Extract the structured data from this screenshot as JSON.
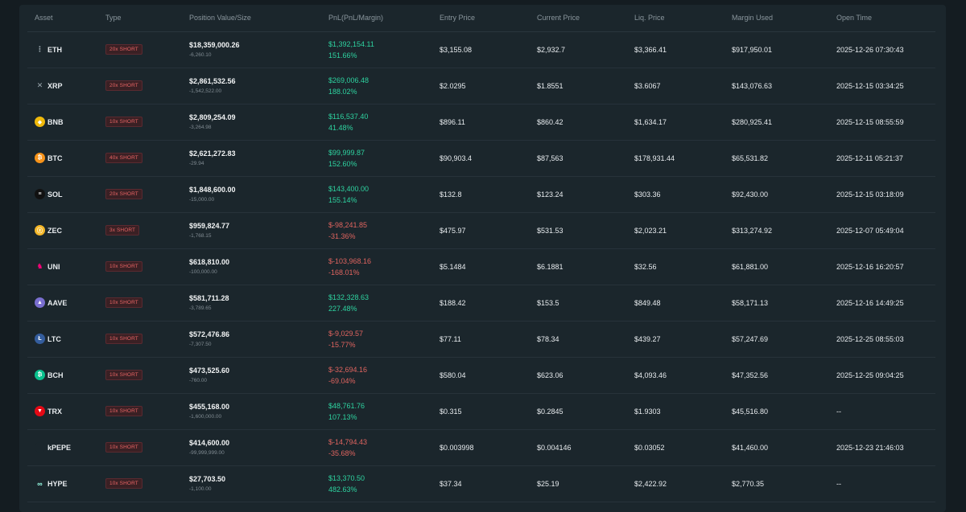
{
  "columns": [
    "Asset",
    "Type",
    "Position Value/Size",
    "PnL(PnL/Margin)",
    "Entry Price",
    "Current Price",
    "Liq. Price",
    "Margin Used",
    "Open Time"
  ],
  "colors": {
    "positive": "#2ed3a0",
    "negative": "#e0645f",
    "badge_text": "#e86464",
    "panel": "#1b262c",
    "background": "#141c21"
  },
  "rows": [
    {
      "asset": "ETH",
      "icon": "eth-icon",
      "icon_color": "#1b262c",
      "icon_glyph": "⋮",
      "type": "20x SHORT",
      "value": "$18,359,000.26",
      "size": "-6,260.10",
      "pnl": "$1,392,154.11",
      "pnl_pct": "151.66%",
      "pnl_sign": "pos",
      "entry": "$3,155.08",
      "current": "$2,932.7",
      "liq": "$3,366.41",
      "margin": "$917,950.01",
      "open_time": "2025-12-26 07:30:43"
    },
    {
      "asset": "XRP",
      "icon": "xrp-icon",
      "icon_color": "#1b262c",
      "icon_glyph": "✕",
      "type": "20x SHORT",
      "value": "$2,861,532.56",
      "size": "-1,542,522.00",
      "pnl": "$269,006.48",
      "pnl_pct": "188.02%",
      "pnl_sign": "pos",
      "entry": "$2.0295",
      "current": "$1.8551",
      "liq": "$3.6067",
      "margin": "$143,076.63",
      "open_time": "2025-12-15 03:34:25"
    },
    {
      "asset": "BNB",
      "icon": "bnb-icon",
      "icon_color": "#f0b90b",
      "icon_glyph": "◆",
      "type": "10x SHORT",
      "value": "$2,809,254.09",
      "size": "-3,264.98",
      "pnl": "$116,537.40",
      "pnl_pct": "41.48%",
      "pnl_sign": "pos",
      "entry": "$896.11",
      "current": "$860.42",
      "liq": "$1,634.17",
      "margin": "$280,925.41",
      "open_time": "2025-12-15 08:55:59"
    },
    {
      "asset": "BTC",
      "icon": "btc-icon",
      "icon_color": "#f7931a",
      "icon_glyph": "₿",
      "type": "40x SHORT",
      "value": "$2,621,272.83",
      "size": "-29.94",
      "pnl": "$99,999.87",
      "pnl_pct": "152.60%",
      "pnl_sign": "pos",
      "entry": "$90,903.4",
      "current": "$87,563",
      "liq": "$178,931.44",
      "margin": "$65,531.82",
      "open_time": "2025-12-11 05:21:37"
    },
    {
      "asset": "SOL",
      "icon": "sol-icon",
      "icon_color": "#111111",
      "icon_glyph": "≡",
      "type": "20x SHORT",
      "value": "$1,848,600.00",
      "size": "-15,000.00",
      "pnl": "$143,400.00",
      "pnl_pct": "155.14%",
      "pnl_sign": "pos",
      "entry": "$132.8",
      "current": "$123.24",
      "liq": "$303.36",
      "margin": "$92,430.00",
      "open_time": "2025-12-15 03:18:09"
    },
    {
      "asset": "ZEC",
      "icon": "zec-icon",
      "icon_color": "#f4b728",
      "icon_glyph": "ⓩ",
      "type": "3x SHORT",
      "value": "$959,824.77",
      "size": "-1,768.15",
      "pnl": "$-98,241.85",
      "pnl_pct": "-31.36%",
      "pnl_sign": "neg",
      "entry": "$475.97",
      "current": "$531.53",
      "liq": "$2,023.21",
      "margin": "$313,274.92",
      "open_time": "2025-12-07 05:49:04"
    },
    {
      "asset": "UNI",
      "icon": "uni-icon",
      "icon_color": "#1b262c",
      "icon_glyph": "♞",
      "type": "10x SHORT",
      "value": "$618,810.00",
      "size": "-100,000.00",
      "pnl": "$-103,968.16",
      "pnl_pct": "-168.01%",
      "pnl_sign": "neg",
      "entry": "$5.1484",
      "current": "$6.1881",
      "liq": "$32.56",
      "margin": "$61,881.00",
      "open_time": "2025-12-16 16:20:57"
    },
    {
      "asset": "AAVE",
      "icon": "aave-icon",
      "icon_color": "#7a6fd0",
      "icon_glyph": "▲",
      "type": "10x SHORT",
      "value": "$581,711.28",
      "size": "-3,789.65",
      "pnl": "$132,328.63",
      "pnl_pct": "227.48%",
      "pnl_sign": "pos",
      "entry": "$188.42",
      "current": "$153.5",
      "liq": "$849.48",
      "margin": "$58,171.13",
      "open_time": "2025-12-16 14:49:25"
    },
    {
      "asset": "LTC",
      "icon": "ltc-icon",
      "icon_color": "#345d9d",
      "icon_glyph": "Ł",
      "type": "10x SHORT",
      "value": "$572,476.86",
      "size": "-7,307.50",
      "pnl": "$-9,029.57",
      "pnl_pct": "-15.77%",
      "pnl_sign": "neg",
      "entry": "$77.11",
      "current": "$78.34",
      "liq": "$439.27",
      "margin": "$57,247.69",
      "open_time": "2025-12-25 08:55:03"
    },
    {
      "asset": "BCH",
      "icon": "bch-icon",
      "icon_color": "#0ac18e",
      "icon_glyph": "₿",
      "type": "10x SHORT",
      "value": "$473,525.60",
      "size": "-760.00",
      "pnl": "$-32,694.16",
      "pnl_pct": "-69.04%",
      "pnl_sign": "neg",
      "entry": "$580.04",
      "current": "$623.06",
      "liq": "$4,093.46",
      "margin": "$47,352.56",
      "open_time": "2025-12-25 09:04:25"
    },
    {
      "asset": "TRX",
      "icon": "trx-icon",
      "icon_color": "#e50915",
      "icon_glyph": "▼",
      "type": "10x SHORT",
      "value": "$455,168.00",
      "size": "-1,600,000.00",
      "pnl": "$48,761.76",
      "pnl_pct": "107.13%",
      "pnl_sign": "pos",
      "entry": "$0.315",
      "current": "$0.2845",
      "liq": "$1.9303",
      "margin": "$45,516.80",
      "open_time": "--"
    },
    {
      "asset": "kPEPE",
      "icon": "pepe-icon",
      "icon_color": "#1b262c",
      "icon_glyph": "",
      "type": "10x SHORT",
      "value": "$414,600.00",
      "size": "-99,999,999.00",
      "pnl": "$-14,794.43",
      "pnl_pct": "-35.68%",
      "pnl_sign": "neg",
      "entry": "$0.003998",
      "current": "$0.004146",
      "liq": "$0.03052",
      "margin": "$41,460.00",
      "open_time": "2025-12-23 21:46:03"
    },
    {
      "asset": "HYPE",
      "icon": "hype-icon",
      "icon_color": "#1b262c",
      "icon_glyph": "∞",
      "type": "10x SHORT",
      "value": "$27,703.50",
      "size": "-1,100.00",
      "pnl": "$13,370.50",
      "pnl_pct": "482.63%",
      "pnl_sign": "pos",
      "entry": "$37.34",
      "current": "$25.19",
      "liq": "$2,422.92",
      "margin": "$2,770.35",
      "open_time": "--"
    }
  ]
}
